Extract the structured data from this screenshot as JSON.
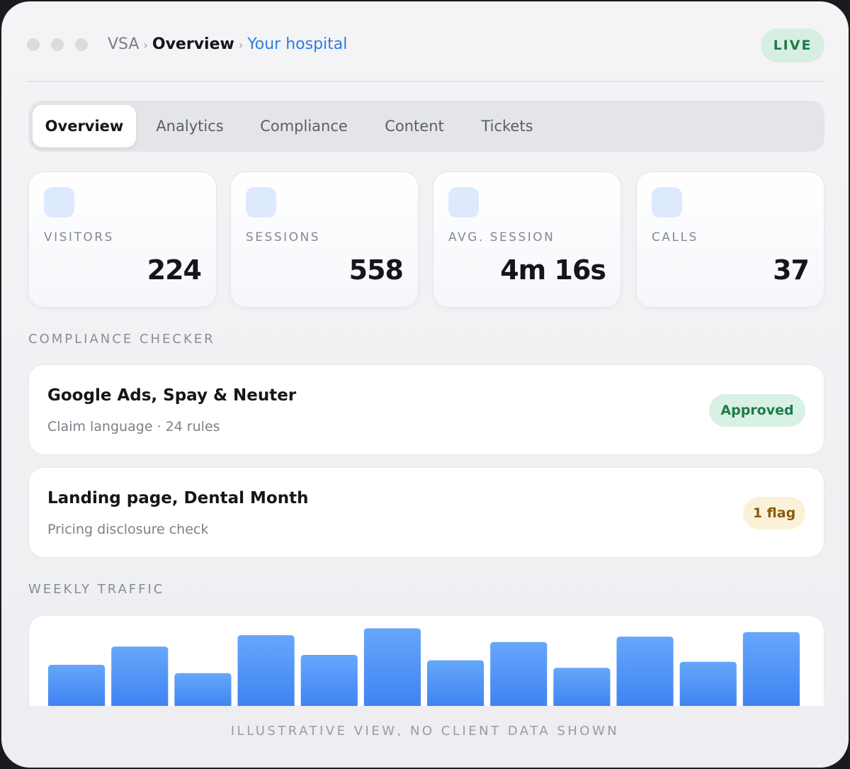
{
  "breadcrumb": {
    "root": "VSA",
    "separator": "›",
    "current": "Overview",
    "link": "Your hospital"
  },
  "status": {
    "label": "LIVE"
  },
  "tabs": [
    {
      "label": "Overview",
      "active": true
    },
    {
      "label": "Analytics",
      "active": false
    },
    {
      "label": "Compliance",
      "active": false
    },
    {
      "label": "Content",
      "active": false
    },
    {
      "label": "Tickets",
      "active": false
    }
  ],
  "stats": [
    {
      "label": "VISITORS",
      "value": "224"
    },
    {
      "label": "SESSIONS",
      "value": "558"
    },
    {
      "label": "AVG. SESSION",
      "value": "4m 16s"
    },
    {
      "label": "CALLS",
      "value": "37"
    }
  ],
  "compliance": {
    "title": "COMPLIANCE CHECKER",
    "items": [
      {
        "title": "Google Ads, Spay & Neuter",
        "subtitle": "Claim language · 24 rules",
        "badge": "Approved",
        "status": "approved"
      },
      {
        "title": "Landing page, Dental Month",
        "subtitle": "Pricing disclosure check",
        "badge": "1 flag",
        "status": "flag"
      }
    ]
  },
  "traffic": {
    "title": "WEEKLY TRAFFIC"
  },
  "chart_data": {
    "type": "bar",
    "values": [
      55,
      79,
      44,
      94,
      68,
      103,
      61,
      85,
      51,
      92,
      59,
      98
    ],
    "ylim": [
      0,
      110
    ],
    "color": "#4a8ef5",
    "grid": false
  },
  "footer": {
    "note": "ILLUSTRATIVE VIEW, NO CLIENT DATA SHOWN"
  },
  "colors": {
    "accent": "#2d7de0",
    "approved": "#1f7a4b",
    "flag": "#8c5a0c",
    "bar": "#4a8ef5"
  }
}
